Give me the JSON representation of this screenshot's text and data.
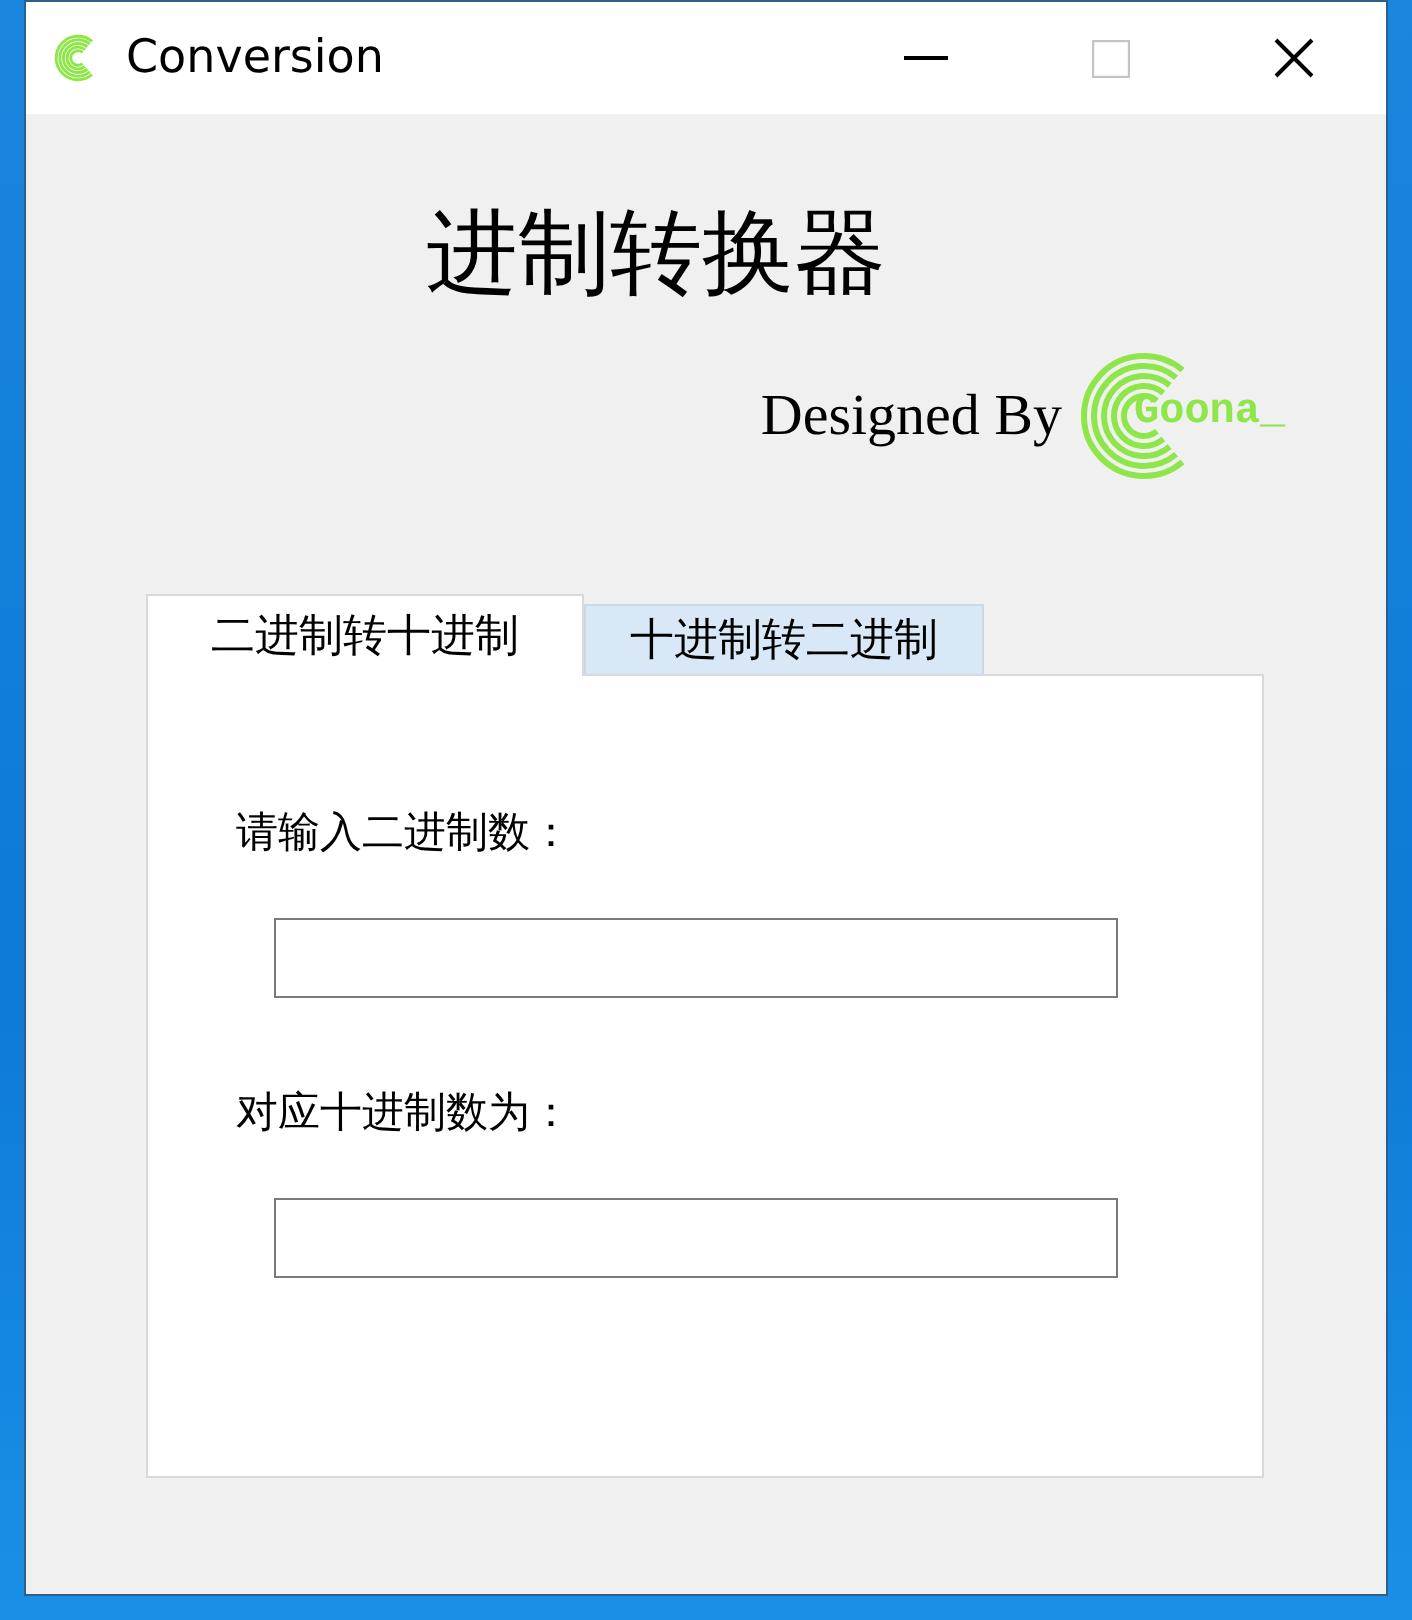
{
  "window": {
    "title": "Conversion",
    "controls": [
      {
        "kind": "minimize",
        "disabled": false
      },
      {
        "kind": "maximize",
        "disabled": true
      },
      {
        "kind": "close",
        "disabled": false
      }
    ]
  },
  "heading": "进制转换器",
  "credit": {
    "text": "Designed By",
    "logo_text": "Goona_"
  },
  "tabs": [
    {
      "label": "二进制转十进制",
      "selected": true
    },
    {
      "label": "十进制转二进制",
      "selected": false
    }
  ],
  "fields": [
    {
      "label": "请输入二进制数："
    },
    {
      "label": "对应十进制数为："
    }
  ]
}
